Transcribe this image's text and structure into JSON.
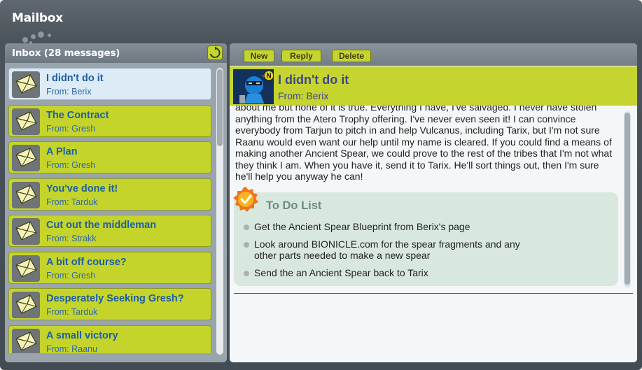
{
  "window": {
    "title": "Mailbox"
  },
  "inbox": {
    "title": "Inbox (28 messages)",
    "refresh_icon": "refresh-icon",
    "messages": [
      {
        "subject": "I didn't do it",
        "from": "From: Berix",
        "selected": true,
        "icon": "envelope-icon"
      },
      {
        "subject": "The Contract",
        "from": "From: Gresh",
        "icon": "envelope-icon"
      },
      {
        "subject": "A Plan",
        "from": "From: Gresh",
        "icon": "envelope-icon"
      },
      {
        "subject": "You've done it!",
        "from": "From: Tarduk",
        "icon": "envelope-icon"
      },
      {
        "subject": "Cut out the middleman",
        "from": "From: Strakk",
        "icon": "envelope-icon"
      },
      {
        "subject": "A bit off course?",
        "from": "From: Gresh",
        "icon": "envelope-icon"
      },
      {
        "subject": "Desperately Seeking Gresh?",
        "from": "From: Tarduk",
        "icon": "envelope-icon"
      },
      {
        "subject": "A small victory",
        "from": "From: Raanu",
        "icon": "envelope-icon"
      }
    ]
  },
  "toolbar": {
    "new_label": "New",
    "reply_label": "Reply",
    "delete_label": "Delete"
  },
  "message": {
    "subject": "I didn't do it",
    "from": "From: Berix",
    "avatar_badge": "N",
    "body_partial_top": "about me but none of it is true. Everything I have, I've salvaged. I never have stolen",
    "body": "anything from the Atero Trophy offering. I've never even seen it! I can convince everybody from Tarjun to pitch in and help Vulcanus, including Tarix, but I'm not sure Raanu would even want our help until my name is cleared. If you could find a means of making another Ancient Spear, we could prove to the rest of the tribes that I'm not what they think I am. When you have it, send it to Tarix. He'll sort things out, then I'm sure he'll help you anyway he can!",
    "todo": {
      "title": "To Do List",
      "badge_icon": "checkmark-badge-icon",
      "items": [
        "Get the Ancient Spear Blueprint from Berix's page",
        "Look around BIONICLE.com for the spear fragments and any other parts needed to make a new spear",
        "Send the an Ancient Spear back to Tarix"
      ]
    }
  },
  "colors": {
    "accent_green": "#c6d42f",
    "selected_row": "#dcebf6",
    "link_blue": "#1d5ea4",
    "header_text": "#3d4690",
    "todo_bg": "#d9e8df"
  }
}
